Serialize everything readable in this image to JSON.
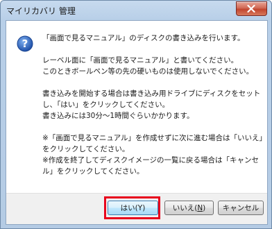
{
  "window": {
    "title": "マイリカバリ 管理"
  },
  "message": {
    "line1": "「画面で見るマニュアル」のディスクの書き込みを行います。",
    "para2": "レーベル面に「画面で見るマニュアル」と書いてください。\nこのときボールペン等の先の硬いものは使用しないでください。",
    "para3": "書き込みを開始する場合は書き込み用ドライブにディスクをセットし、「はい」をクリックしてください。\n書き込みには30分〜1時間ぐらいかかります。",
    "para4": "※「画面で見るマニュアル」を作成せずに次に進む場合は「いいえ」をクリックしてください。\n※作成を終了してディスクイメージの一覧に戻る場合は「キャンセル」をクリックしてください。"
  },
  "buttons": {
    "yes_label": "はい",
    "yes_key": "Y",
    "no_label": "いいえ",
    "no_key": "N",
    "cancel_label": "キャンセル"
  },
  "colors": {
    "highlight": "#e8001c",
    "question_icon": "#2a63c4"
  },
  "icons": {
    "dialog_icon": "question-icon",
    "close_icon": "close-icon"
  }
}
